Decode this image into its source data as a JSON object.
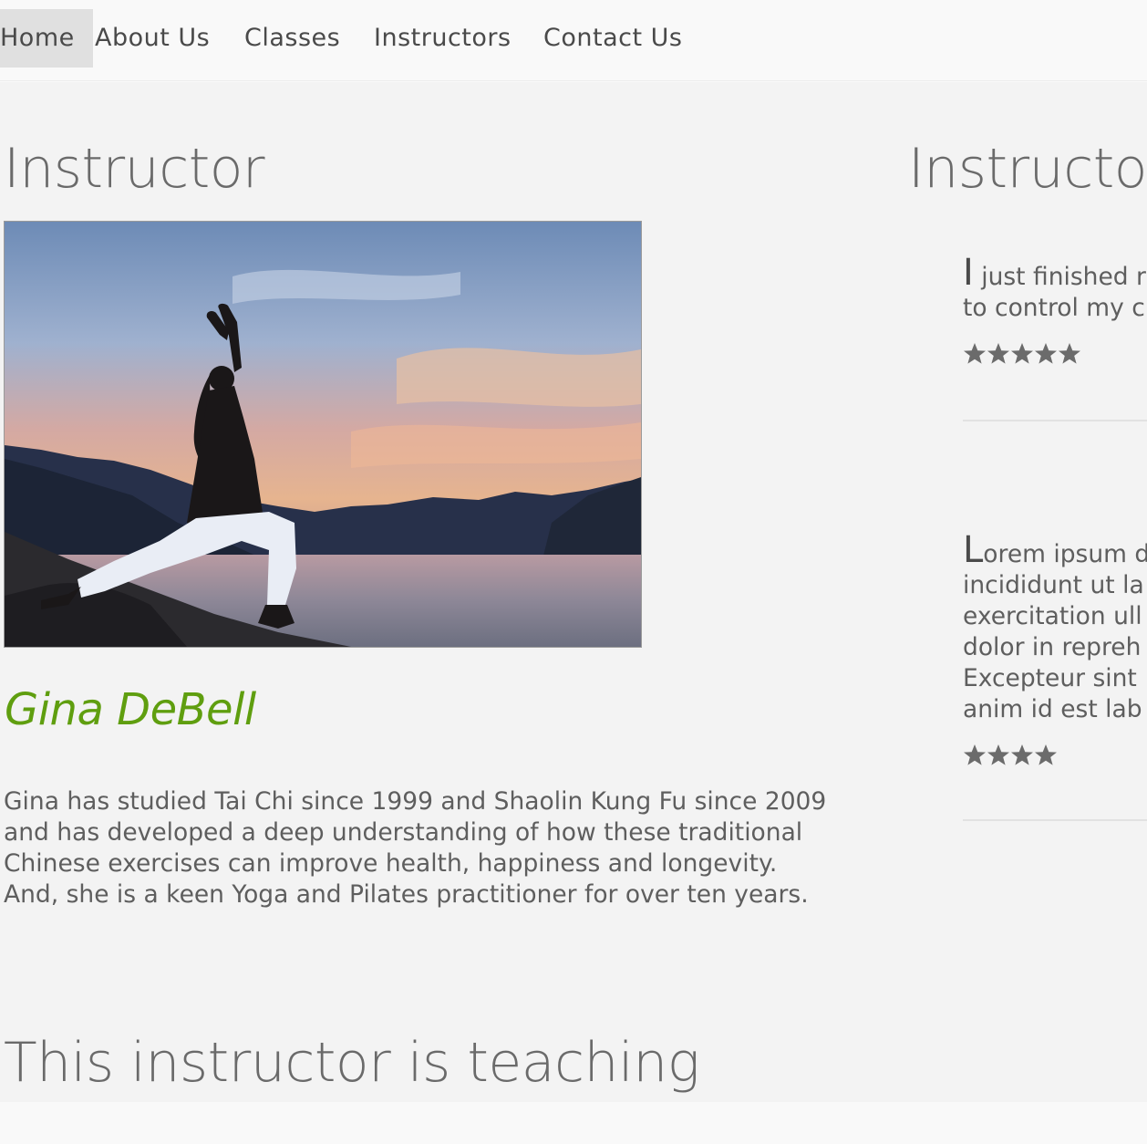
{
  "nav": {
    "items": [
      {
        "label": "Home",
        "active": true
      },
      {
        "label": "About Us",
        "active": false
      },
      {
        "label": "Classes",
        "active": false
      },
      {
        "label": "Instructors",
        "active": false
      },
      {
        "label": "Contact Us",
        "active": false
      }
    ]
  },
  "left": {
    "heading": "Instructor",
    "photo": {
      "subject": "yoga-pose-silhouette-at-sunset-by-river"
    },
    "name": "Gina DeBell",
    "bio": "Gina has studied Tai Chi since 1999 and Shaolin Kung Fu since 2009 and has developed a deep understanding of how these traditional Chinese exercises can improve health, happiness and longevity. And, she is a keen Yoga and Pilates practitioner for over ten years."
  },
  "right": {
    "heading": "Instructo",
    "reviews": [
      {
        "initial": "I",
        "lines": [
          " just finished r",
          "to control my c"
        ],
        "rating": 5
      },
      {
        "initial": "L",
        "lines": [
          "orem ipsum d",
          "incididunt ut la",
          "exercitation ull",
          "dolor in repreh",
          "Excepteur sint",
          "anim id est lab"
        ],
        "rating": 4
      }
    ]
  },
  "teaching": {
    "heading": "This instructor is teaching"
  },
  "colors": {
    "accent": "#5f9e0f",
    "text": "#5e5e5e",
    "heading": "#6a6a6a",
    "star": "#6b6b6b",
    "nav_active_bg": "#e0e0e0",
    "page_bg": "#f3f3f3"
  }
}
